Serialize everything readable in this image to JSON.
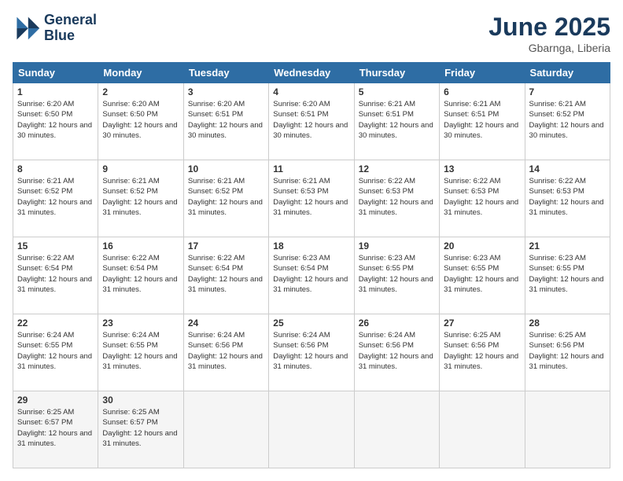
{
  "logo": {
    "line1": "General",
    "line2": "Blue"
  },
  "title": "June 2025",
  "subtitle": "Gbarnga, Liberia",
  "weekdays": [
    "Sunday",
    "Monday",
    "Tuesday",
    "Wednesday",
    "Thursday",
    "Friday",
    "Saturday"
  ],
  "weeks": [
    [
      {
        "day": "1",
        "sunrise": "6:20 AM",
        "sunset": "6:50 PM",
        "daylight": "12 hours and 30 minutes."
      },
      {
        "day": "2",
        "sunrise": "6:20 AM",
        "sunset": "6:50 PM",
        "daylight": "12 hours and 30 minutes."
      },
      {
        "day": "3",
        "sunrise": "6:20 AM",
        "sunset": "6:51 PM",
        "daylight": "12 hours and 30 minutes."
      },
      {
        "day": "4",
        "sunrise": "6:20 AM",
        "sunset": "6:51 PM",
        "daylight": "12 hours and 30 minutes."
      },
      {
        "day": "5",
        "sunrise": "6:21 AM",
        "sunset": "6:51 PM",
        "daylight": "12 hours and 30 minutes."
      },
      {
        "day": "6",
        "sunrise": "6:21 AM",
        "sunset": "6:51 PM",
        "daylight": "12 hours and 30 minutes."
      },
      {
        "day": "7",
        "sunrise": "6:21 AM",
        "sunset": "6:52 PM",
        "daylight": "12 hours and 30 minutes."
      }
    ],
    [
      {
        "day": "8",
        "sunrise": "6:21 AM",
        "sunset": "6:52 PM",
        "daylight": "12 hours and 31 minutes."
      },
      {
        "day": "9",
        "sunrise": "6:21 AM",
        "sunset": "6:52 PM",
        "daylight": "12 hours and 31 minutes."
      },
      {
        "day": "10",
        "sunrise": "6:21 AM",
        "sunset": "6:52 PM",
        "daylight": "12 hours and 31 minutes."
      },
      {
        "day": "11",
        "sunrise": "6:21 AM",
        "sunset": "6:53 PM",
        "daylight": "12 hours and 31 minutes."
      },
      {
        "day": "12",
        "sunrise": "6:22 AM",
        "sunset": "6:53 PM",
        "daylight": "12 hours and 31 minutes."
      },
      {
        "day": "13",
        "sunrise": "6:22 AM",
        "sunset": "6:53 PM",
        "daylight": "12 hours and 31 minutes."
      },
      {
        "day": "14",
        "sunrise": "6:22 AM",
        "sunset": "6:53 PM",
        "daylight": "12 hours and 31 minutes."
      }
    ],
    [
      {
        "day": "15",
        "sunrise": "6:22 AM",
        "sunset": "6:54 PM",
        "daylight": "12 hours and 31 minutes."
      },
      {
        "day": "16",
        "sunrise": "6:22 AM",
        "sunset": "6:54 PM",
        "daylight": "12 hours and 31 minutes."
      },
      {
        "day": "17",
        "sunrise": "6:22 AM",
        "sunset": "6:54 PM",
        "daylight": "12 hours and 31 minutes."
      },
      {
        "day": "18",
        "sunrise": "6:23 AM",
        "sunset": "6:54 PM",
        "daylight": "12 hours and 31 minutes."
      },
      {
        "day": "19",
        "sunrise": "6:23 AM",
        "sunset": "6:55 PM",
        "daylight": "12 hours and 31 minutes."
      },
      {
        "day": "20",
        "sunrise": "6:23 AM",
        "sunset": "6:55 PM",
        "daylight": "12 hours and 31 minutes."
      },
      {
        "day": "21",
        "sunrise": "6:23 AM",
        "sunset": "6:55 PM",
        "daylight": "12 hours and 31 minutes."
      }
    ],
    [
      {
        "day": "22",
        "sunrise": "6:24 AM",
        "sunset": "6:55 PM",
        "daylight": "12 hours and 31 minutes."
      },
      {
        "day": "23",
        "sunrise": "6:24 AM",
        "sunset": "6:55 PM",
        "daylight": "12 hours and 31 minutes."
      },
      {
        "day": "24",
        "sunrise": "6:24 AM",
        "sunset": "6:56 PM",
        "daylight": "12 hours and 31 minutes."
      },
      {
        "day": "25",
        "sunrise": "6:24 AM",
        "sunset": "6:56 PM",
        "daylight": "12 hours and 31 minutes."
      },
      {
        "day": "26",
        "sunrise": "6:24 AM",
        "sunset": "6:56 PM",
        "daylight": "12 hours and 31 minutes."
      },
      {
        "day": "27",
        "sunrise": "6:25 AM",
        "sunset": "6:56 PM",
        "daylight": "12 hours and 31 minutes."
      },
      {
        "day": "28",
        "sunrise": "6:25 AM",
        "sunset": "6:56 PM",
        "daylight": "12 hours and 31 minutes."
      }
    ],
    [
      {
        "day": "29",
        "sunrise": "6:25 AM",
        "sunset": "6:57 PM",
        "daylight": "12 hours and 31 minutes."
      },
      {
        "day": "30",
        "sunrise": "6:25 AM",
        "sunset": "6:57 PM",
        "daylight": "12 hours and 31 minutes."
      },
      null,
      null,
      null,
      null,
      null
    ]
  ],
  "labels": {
    "sunrise": "Sunrise:",
    "sunset": "Sunset:",
    "daylight": "Daylight:"
  }
}
